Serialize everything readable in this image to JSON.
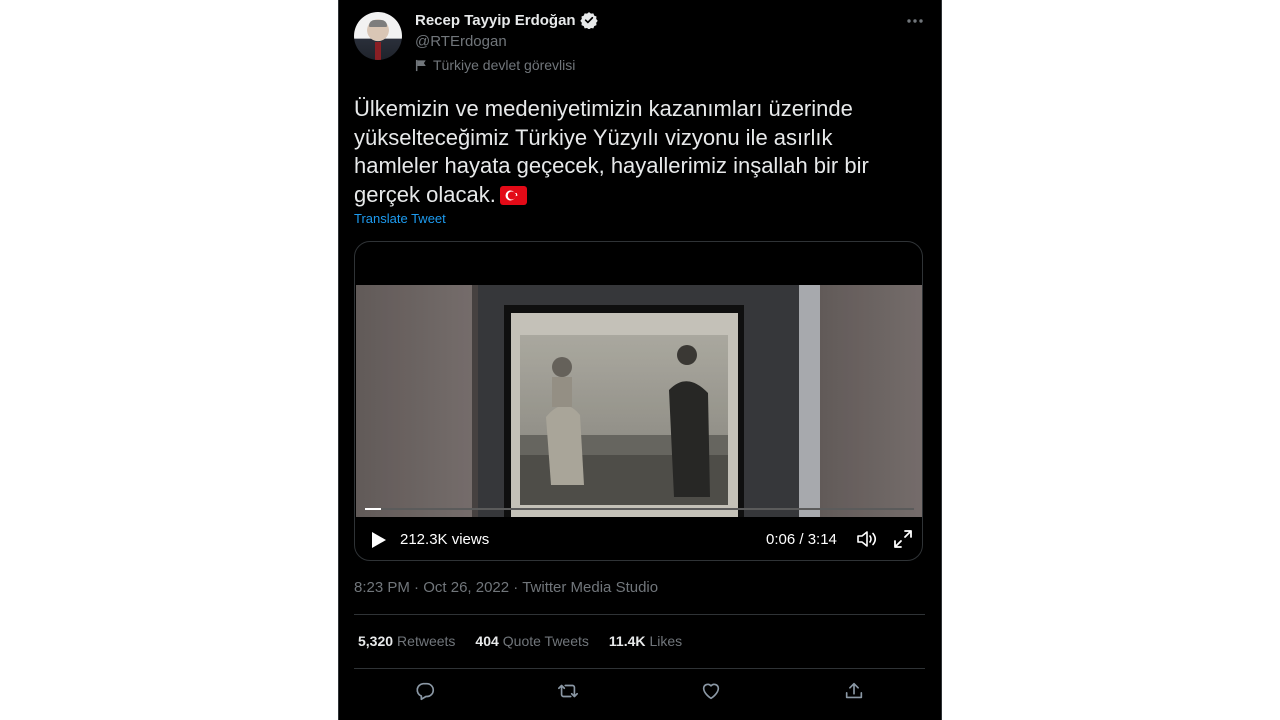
{
  "author": {
    "display_name": "Recep Tayyip Erdoğan",
    "handle": "@RTErdogan",
    "label": "Türkiye devlet görevlisi"
  },
  "tweet": {
    "text": "Ülkemizin ve medeniyetimizin kazanımları üzerinde yükselteceğimiz Türkiye Yüzyılı vizyonu ile asırlık hamleler hayata geçecek, hayallerimiz inşallah bir bir gerçek olacak.",
    "translate_label": "Translate Tweet"
  },
  "video": {
    "views": "212.3K views",
    "time": "0:06 / 3:14",
    "progress_fraction": 0.03
  },
  "meta": {
    "time": "8:23 PM",
    "date": "Oct 26, 2022",
    "source": "Twitter Media Studio",
    "separator": "·"
  },
  "stats": {
    "retweets_count": "5,320",
    "retweets_label": "Retweets",
    "quotes_count": "404",
    "quotes_label": "Quote Tweets",
    "likes_count": "11.4K",
    "likes_label": "Likes"
  },
  "colors": {
    "background": "#000000",
    "text": "#e7e9ea",
    "secondary": "#71767b",
    "link": "#1d9bf0",
    "flag_red": "#e30a17"
  },
  "icons": {
    "verified": "verified-badge-icon",
    "government_label": "flag-icon",
    "more": "more-icon",
    "play": "play-icon",
    "volume": "volume-icon",
    "fullscreen": "fullscreen-icon",
    "reply": "reply-icon",
    "retweet": "retweet-icon",
    "like": "like-icon",
    "share": "share-icon"
  }
}
